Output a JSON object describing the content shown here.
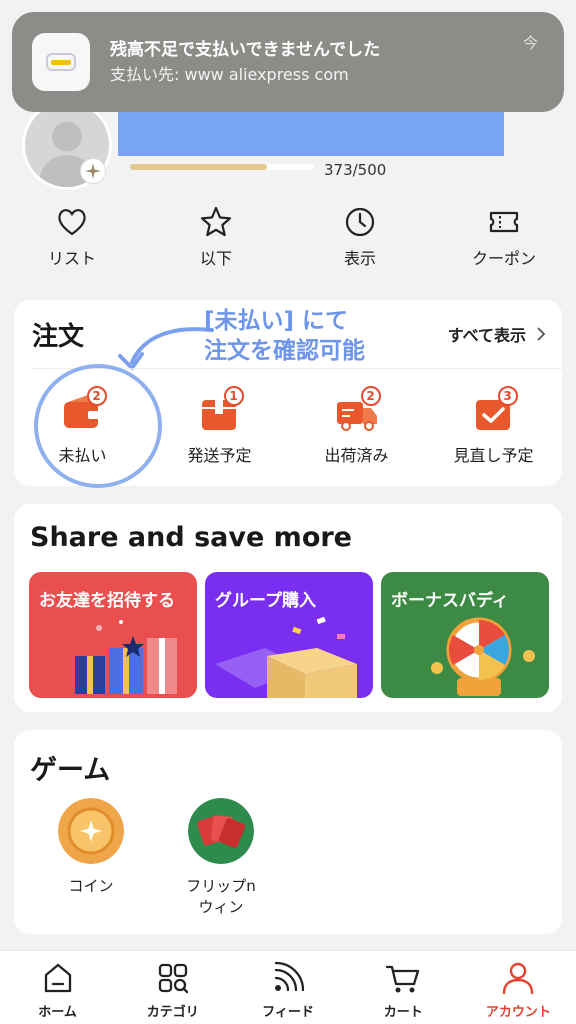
{
  "notification": {
    "title": "残高不足で支払いできませんでした",
    "body": "支払い先: www aliexpress com",
    "time": "今",
    "app_icon": "wallet-app-icon"
  },
  "profile": {
    "progress_text": "373/500",
    "progress_fraction": 0.746,
    "redaction_color": "#7aa4f5"
  },
  "quick_links": [
    {
      "label": "リスト",
      "icon": "heart-icon"
    },
    {
      "label": "以下",
      "icon": "star-icon"
    },
    {
      "label": "表示",
      "icon": "clock-icon"
    },
    {
      "label": "クーポン",
      "icon": "ticket-icon"
    }
  ],
  "orders": {
    "title": "注文",
    "view_all": "すべて表示",
    "annotation_line1": "[未払い] にて",
    "annotation_line2": "注文を確認可能",
    "annotation_color": "#6d95ec",
    "items": [
      {
        "label": "未払い",
        "count": "2",
        "icon": "wallet-icon"
      },
      {
        "label": "発送予定",
        "count": "1",
        "icon": "package-icon"
      },
      {
        "label": "出荷済み",
        "count": "2",
        "icon": "truck-icon"
      },
      {
        "label": "見直し予定",
        "count": "3",
        "icon": "review-icon"
      }
    ]
  },
  "share": {
    "title": "Share and save more",
    "tiles": [
      {
        "label": "お友達を招待する",
        "color": "#e94f4f"
      },
      {
        "label": "グループ購入",
        "color": "#7a2ff0"
      },
      {
        "label": "ボーナスバディ",
        "color": "#3c8a44"
      }
    ]
  },
  "games": {
    "title": "ゲーム",
    "items": [
      {
        "label": "コイン",
        "icon": "coin-icon"
      },
      {
        "label": "フリップn\nウィン",
        "icon": "flip-cards-icon"
      }
    ]
  },
  "nav": {
    "items": [
      {
        "label": "ホーム",
        "icon": "home-icon",
        "active": false
      },
      {
        "label": "カテゴリ",
        "icon": "category-icon",
        "active": false
      },
      {
        "label": "フィード",
        "icon": "feed-icon",
        "active": false
      },
      {
        "label": "カート",
        "icon": "cart-icon",
        "active": false
      },
      {
        "label": "アカウント",
        "icon": "account-icon",
        "active": true
      }
    ],
    "active_color": "#e6412e"
  }
}
